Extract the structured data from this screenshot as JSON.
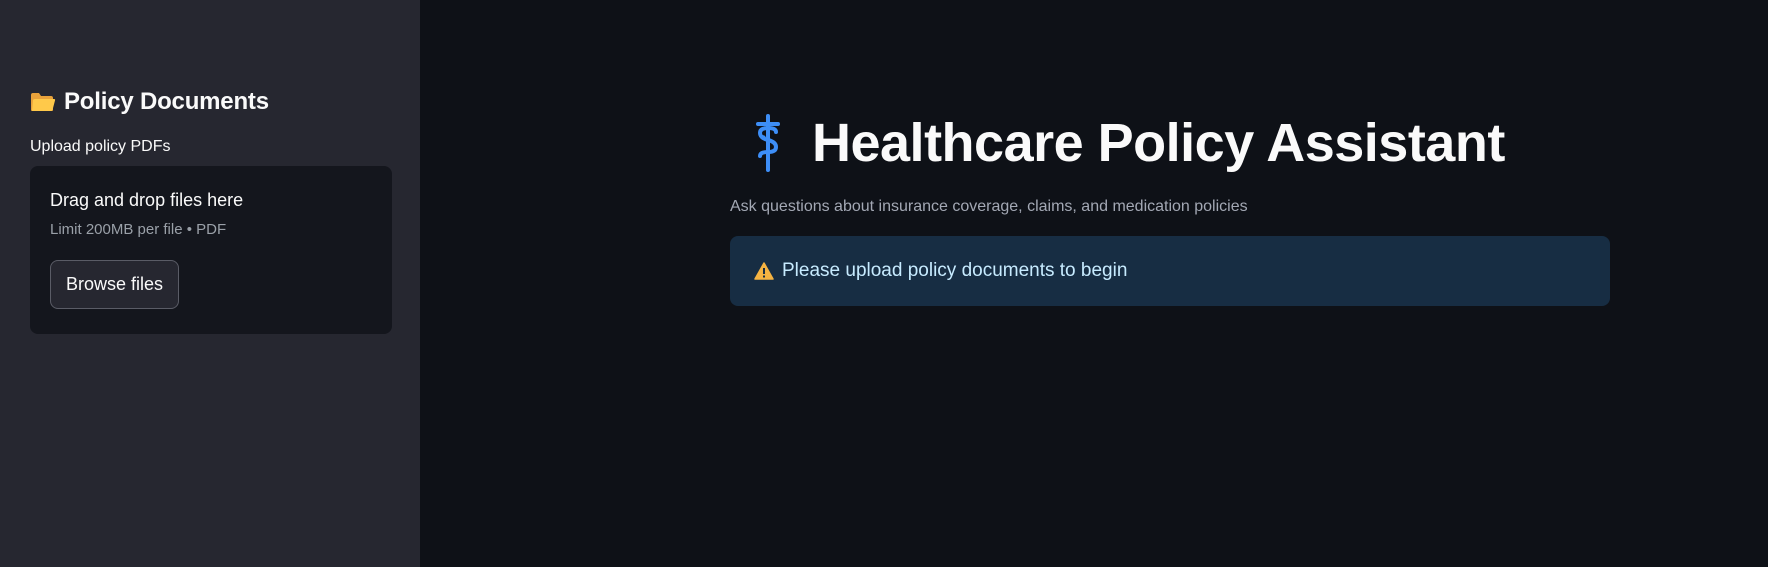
{
  "sidebar": {
    "header_icon": "folder-icon",
    "title": "Policy Documents",
    "uploader": {
      "label": "Upload policy PDFs",
      "dropzone_title": "Drag and drop files here",
      "dropzone_limit": "Limit 200MB per file • PDF",
      "browse_label": "Browse files"
    }
  },
  "main": {
    "title_icon": "caduceus-icon",
    "title": "Healthcare Policy Assistant",
    "subtitle": "Ask questions about insurance coverage, claims, and medication policies",
    "alert": {
      "icon": "warning-icon",
      "text": "Please upload policy documents to begin"
    }
  },
  "colors": {
    "sidebar_bg": "#262730",
    "main_bg": "#0e1117",
    "accent_blue": "#3d8ef7",
    "alert_bg": "#172d43",
    "warning": "#f5b342"
  }
}
